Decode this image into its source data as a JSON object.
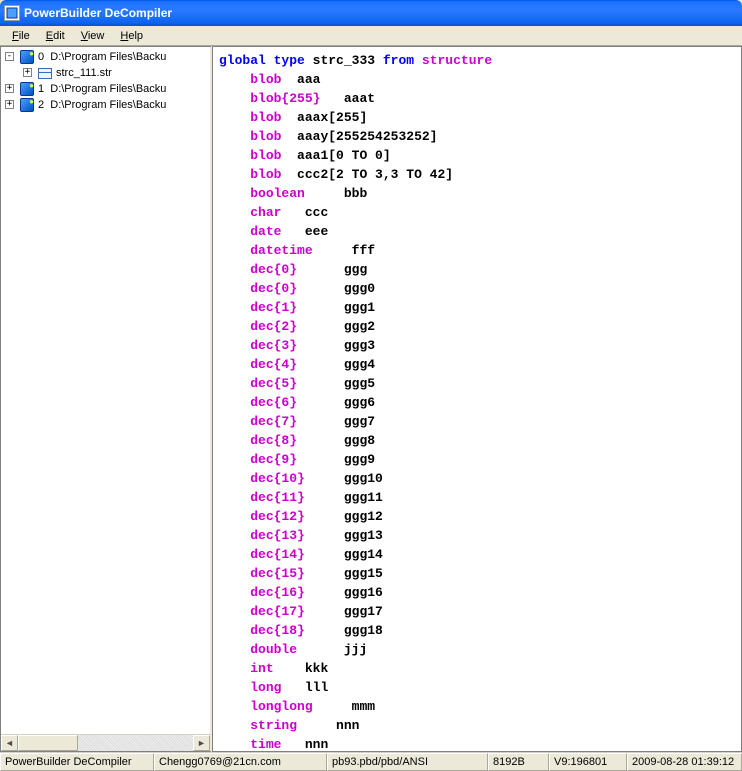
{
  "window": {
    "title": "PowerBuilder DeCompiler"
  },
  "menu": {
    "file": "File",
    "edit": "Edit",
    "view": "View",
    "help": "Help"
  },
  "tree": {
    "root0": {
      "idx": "0",
      "label": "D:\\Program Files\\Backu"
    },
    "child": {
      "label": "strc_111.str"
    },
    "root1": {
      "idx": "1",
      "label": "D:\\Program Files\\Backu"
    },
    "root2": {
      "idx": "2",
      "label": "D:\\Program Files\\Backu"
    }
  },
  "code": {
    "line0": {
      "k1": "global type",
      "n": "strc_333",
      "k2": "from",
      "t": "structure"
    },
    "lines": [
      {
        "kw": "blob",
        "id": "aaa"
      },
      {
        "kw": "blob{255}",
        "id": " aaat"
      },
      {
        "kw": "blob",
        "id": "aaax[255]"
      },
      {
        "kw": "blob",
        "id": "aaay[255254253252]"
      },
      {
        "kw": "blob",
        "id": "aaa1[0 TO 0]"
      },
      {
        "kw": "blob",
        "id": "ccc2[2 TO 3,3 TO 42]"
      },
      {
        "kw": "boolean",
        "id": "   bbb"
      },
      {
        "kw": "char",
        "id": " ccc"
      },
      {
        "kw": "date",
        "id": " eee"
      },
      {
        "kw": "datetime",
        "id": "   fff"
      },
      {
        "kw": "dec{0}",
        "id": "    ggg"
      },
      {
        "kw": "dec{0}",
        "id": "    ggg0"
      },
      {
        "kw": "dec{1}",
        "id": "    ggg1"
      },
      {
        "kw": "dec{2}",
        "id": "    ggg2"
      },
      {
        "kw": "dec{3}",
        "id": "    ggg3"
      },
      {
        "kw": "dec{4}",
        "id": "    ggg4"
      },
      {
        "kw": "dec{5}",
        "id": "    ggg5"
      },
      {
        "kw": "dec{6}",
        "id": "    ggg6"
      },
      {
        "kw": "dec{7}",
        "id": "    ggg7"
      },
      {
        "kw": "dec{8}",
        "id": "    ggg8"
      },
      {
        "kw": "dec{9}",
        "id": "    ggg9"
      },
      {
        "kw": "dec{10}",
        "id": "   ggg10"
      },
      {
        "kw": "dec{11}",
        "id": "   ggg11"
      },
      {
        "kw": "dec{12}",
        "id": "   ggg12"
      },
      {
        "kw": "dec{13}",
        "id": "   ggg13"
      },
      {
        "kw": "dec{14}",
        "id": "   ggg14"
      },
      {
        "kw": "dec{15}",
        "id": "   ggg15"
      },
      {
        "kw": "dec{16}",
        "id": "   ggg16"
      },
      {
        "kw": "dec{17}",
        "id": "   ggg17"
      },
      {
        "kw": "dec{18}",
        "id": "   ggg18"
      },
      {
        "kw": "double",
        "id": "    jjj"
      },
      {
        "kw": "int",
        "id": "  kkk"
      },
      {
        "kw": "long",
        "id": " lll"
      },
      {
        "kw": "longlong",
        "id": "   mmm"
      },
      {
        "kw": "string",
        "id": "   nnn"
      },
      {
        "kw": "time",
        "id": " nnn"
      }
    ]
  },
  "status": {
    "c0": "PowerBuilder DeCompiler",
    "c1": "Chengg0769@21cn.com",
    "c2": "pb93.pbd/pbd/ANSI",
    "c3": "8192B",
    "c4": "V9:196801",
    "c5": "2009-08-28 01:39:12"
  }
}
